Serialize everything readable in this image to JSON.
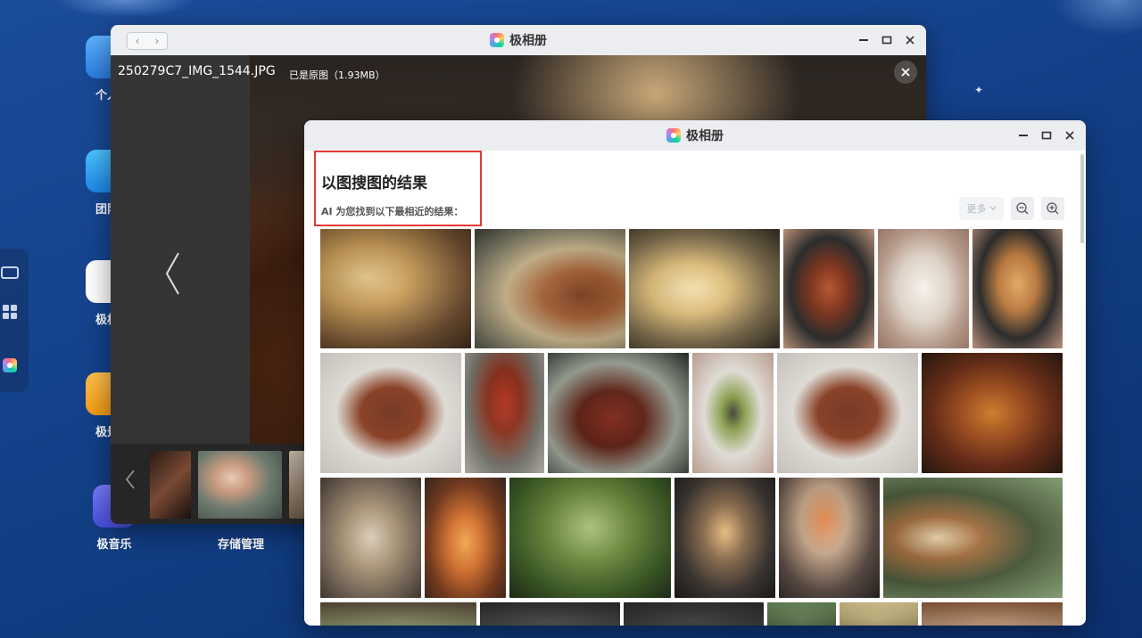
{
  "desktop": {
    "icons": [
      {
        "label": "个人"
      },
      {
        "label": "团队"
      },
      {
        "label": "极相"
      },
      {
        "label": "极景"
      },
      {
        "label": "极音乐"
      },
      {
        "label": "存储管理"
      }
    ]
  },
  "viewer_window": {
    "title": "极相册",
    "file_name": "250279C7_IMG_1544.JPG",
    "original_status": "已是原图（1.93MB）"
  },
  "result_window": {
    "title": "极相册",
    "heading": "以图搜图的结果",
    "subtitle": "AI 为您找到以下最相近的结果：",
    "more_label": "更多"
  },
  "colors": {
    "desktop_bg": "#14418a",
    "highlight_red": "#e53935",
    "titlebar": "#ebedf0"
  }
}
